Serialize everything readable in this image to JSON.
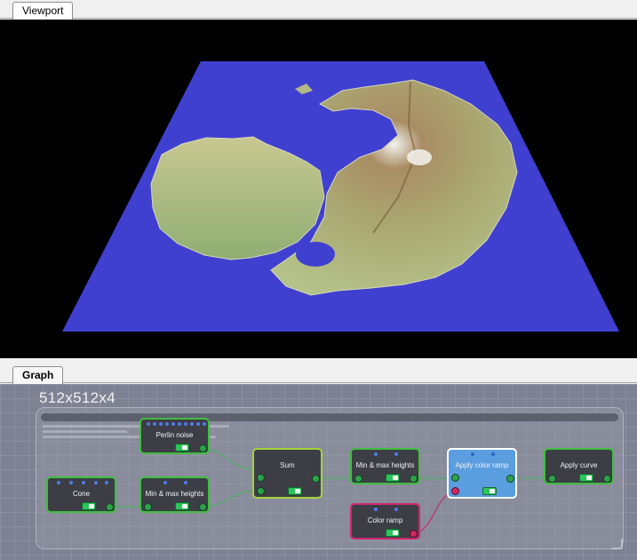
{
  "tabs": {
    "viewport": "Viewport",
    "graph": "Graph"
  },
  "graph": {
    "resolution": "512x512x4",
    "nodes": {
      "perlin_noise": "Perlin noise",
      "cone": "Cone",
      "min_max_1": "Min & max heights",
      "sum": "Sum",
      "min_max_2": "Min & max heights",
      "color_ramp": "Color ramp",
      "apply_color_ramp": "Apply color ramp",
      "apply_curve": "Apply curve"
    }
  },
  "colors": {
    "sea": "#4040d0",
    "node_border": "#3fbf3f",
    "node_selected": "#5a9ee0",
    "color_ramp_border": "#d0286e",
    "sum_border": "#a6d23c"
  },
  "icons": [
    "resize-grip-icon"
  ]
}
